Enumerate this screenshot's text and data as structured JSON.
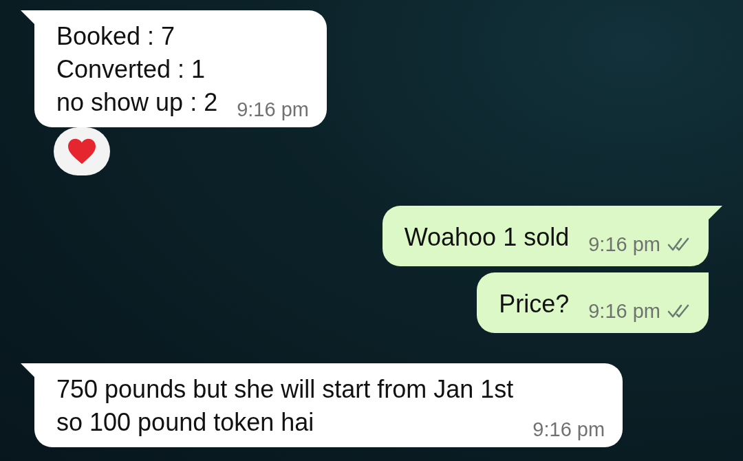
{
  "messages": [
    {
      "kind": "incoming",
      "tail": true,
      "text": "Booked : 7\nConverted : 1\nno show up : 2",
      "time": "9:16 pm",
      "has_reaction": true
    },
    {
      "kind": "outgoing",
      "tail": true,
      "text": "Woahoo 1 sold",
      "time": "9:16 pm",
      "delivered": true
    },
    {
      "kind": "outgoing",
      "tail": false,
      "text": "Price?",
      "time": "9:16 pm",
      "delivered": true
    },
    {
      "kind": "incoming",
      "tail": true,
      "text": "750 pounds but she will start from Jan 1st\nso 100 pound token hai",
      "time": "9:16 pm"
    }
  ]
}
